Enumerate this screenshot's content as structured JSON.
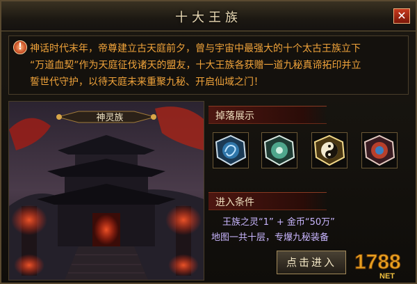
{
  "window": {
    "title": "十大王族"
  },
  "intro": {
    "lines": [
      "神话时代末年，帝尊建立古天庭前夕，曾与宇宙中最强大的十个太古王族立下",
      "“万道血契”作为天庭征伐诸天的盟友，十大王族各获赠一道九秘真谛拓印并立",
      "誓世代守护，以待天庭未来重聚九秘、开启仙域之门！"
    ]
  },
  "scene": {
    "clan_name": "神灵族"
  },
  "drops": {
    "title": "掉落展示",
    "items": [
      {
        "icon": "dragon-medallion-icon",
        "color": "#3a8cc8"
      },
      {
        "icon": "jade-medallion-icon",
        "color": "#5ab39a"
      },
      {
        "icon": "taiji-medallion-icon",
        "color": "#d8b24a"
      },
      {
        "icon": "crimson-medallion-icon",
        "color": "#c84a32"
      }
    ]
  },
  "conditions": {
    "title": "进入条件",
    "line1": "王族之灵“1”  + 金币“50万”",
    "line2": "地图一共十层，专爆九秘装备"
  },
  "actions": {
    "enter_label": "点击进入"
  },
  "watermark": {
    "text": "1788",
    "sub": "NET"
  },
  "colors": {
    "accent_text": "#f0a33a",
    "condition_text": "#c9b6ff",
    "close_button": "#b3301a"
  }
}
